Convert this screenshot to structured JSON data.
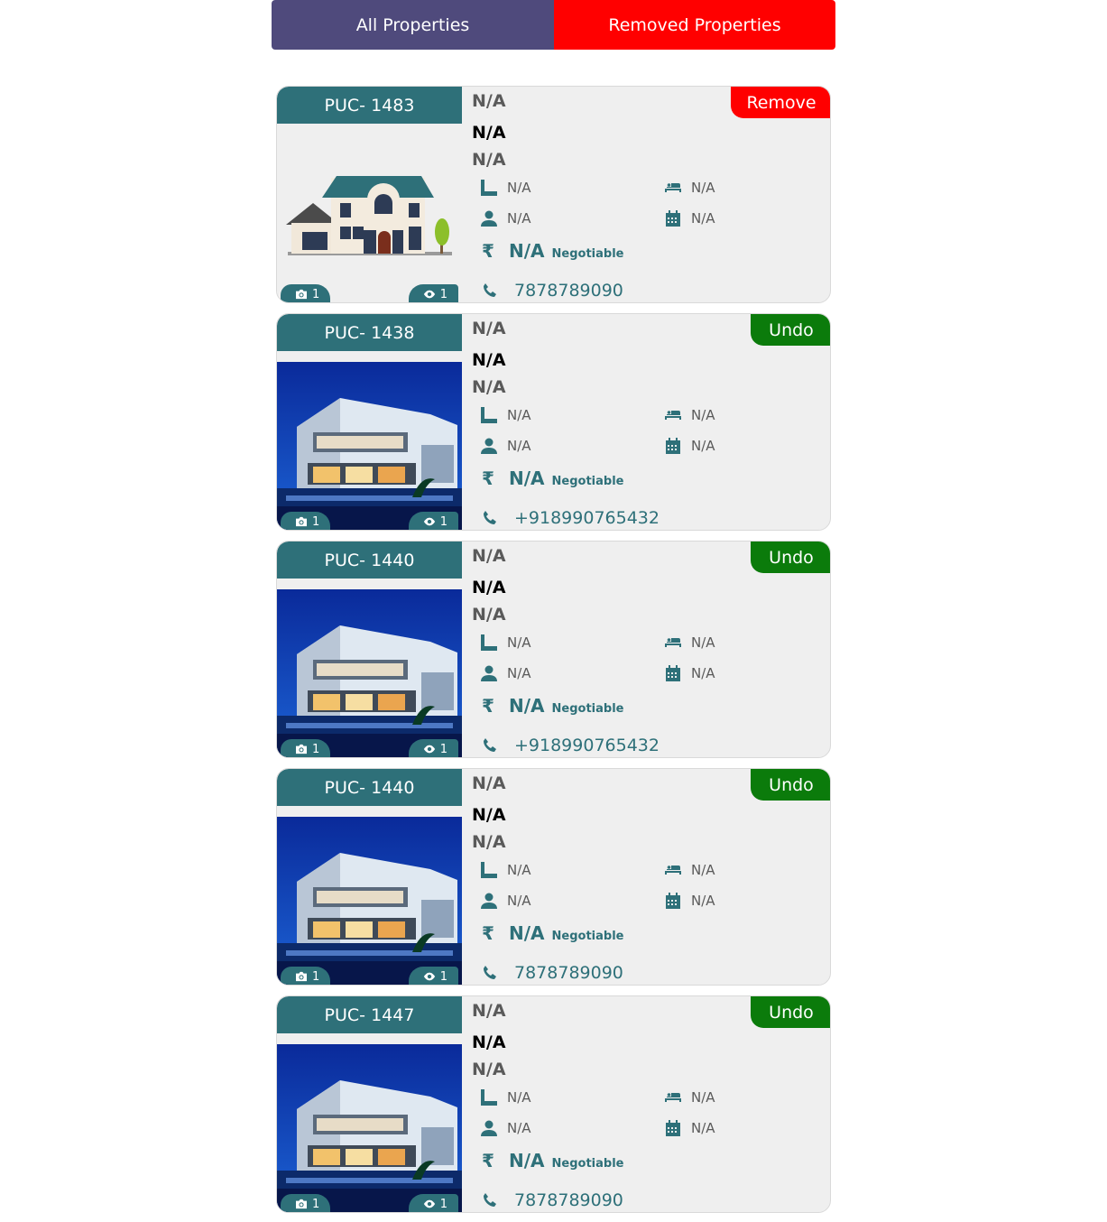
{
  "tabs": {
    "all": "All Properties",
    "removed": "Removed Properties"
  },
  "colors": {
    "teal": "#2e7079",
    "red": "#ff0000",
    "green": "#0b7b0b",
    "purple": "#4f4a7c"
  },
  "cards": [
    {
      "code": "PUC- 1483",
      "image": "house-illustration",
      "photos": "1",
      "views": "1",
      "title": "N/A",
      "subtitle": "N/A",
      "location": "N/A",
      "area": "N/A",
      "beds": "N/A",
      "owner": "N/A",
      "date": "N/A",
      "currency": "₹",
      "price": "N/A",
      "negotiable": "Negotiable",
      "phone": "7878789090",
      "action": "Remove"
    },
    {
      "code": "PUC- 1438",
      "image": "modern-villa-photo",
      "photos": "1",
      "views": "1",
      "title": "N/A",
      "subtitle": "N/A",
      "location": "N/A",
      "area": "N/A",
      "beds": "N/A",
      "owner": "N/A",
      "date": "N/A",
      "currency": "₹",
      "price": "N/A",
      "negotiable": "Negotiable",
      "phone": "+918990765432",
      "action": "Undo"
    },
    {
      "code": "PUC- 1440",
      "image": "modern-villa-photo",
      "photos": "1",
      "views": "1",
      "title": "N/A",
      "subtitle": "N/A",
      "location": "N/A",
      "area": "N/A",
      "beds": "N/A",
      "owner": "N/A",
      "date": "N/A",
      "currency": "₹",
      "price": "N/A",
      "negotiable": "Negotiable",
      "phone": "+918990765432",
      "action": "Undo"
    },
    {
      "code": "PUC- 1440",
      "image": "modern-villa-photo",
      "photos": "1",
      "views": "1",
      "title": "N/A",
      "subtitle": "N/A",
      "location": "N/A",
      "area": "N/A",
      "beds": "N/A",
      "owner": "N/A",
      "date": "N/A",
      "currency": "₹",
      "price": "N/A",
      "negotiable": "Negotiable",
      "phone": "7878789090",
      "action": "Undo"
    },
    {
      "code": "PUC- 1447",
      "image": "modern-villa-photo",
      "photos": "1",
      "views": "1",
      "title": "N/A",
      "subtitle": "N/A",
      "location": "N/A",
      "area": "N/A",
      "beds": "N/A",
      "owner": "N/A",
      "date": "N/A",
      "currency": "₹",
      "price": "N/A",
      "negotiable": "Negotiable",
      "phone": "7878789090",
      "action": "Undo"
    }
  ]
}
